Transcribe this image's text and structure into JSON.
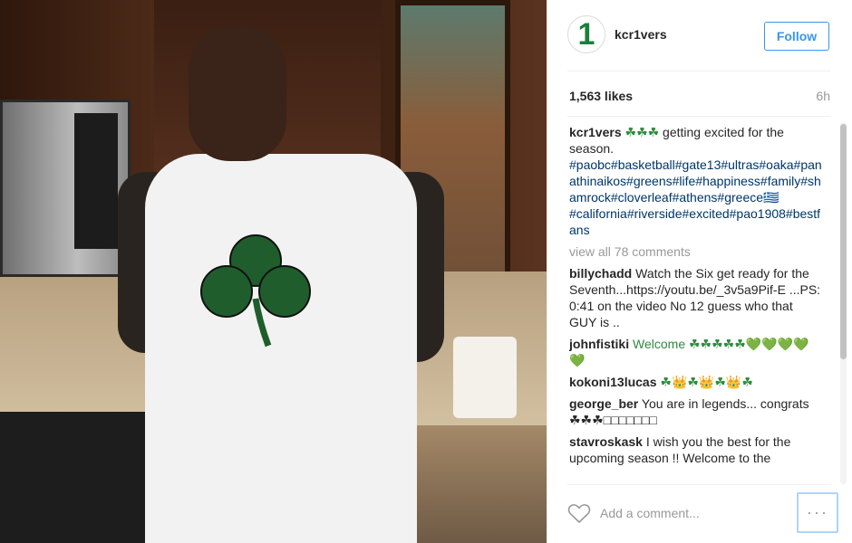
{
  "post": {
    "username": "kcr1vers",
    "avatar_glyph": "1",
    "follow_label": "Follow",
    "likes": "1,563 likes",
    "time": "6h",
    "caption_text": " getting excited for the season. ",
    "caption_emoji": "☘☘☘",
    "hashtags": "#paobc#basketball#gate13#ultras#oaka#panathinaikos#greens#life#happiness#family#shamrock#cloverleaf#athens#greece🇬🇷#california#riverside#excited#pao1908#bestfans",
    "view_all": "view all 78 comments"
  },
  "comments": [
    {
      "user": "billychadd",
      "text": "Watch the Six get ready for the Seventh...https://youtu.be/_3v5a9Pif-E ...PS: 0:41 on the video No 12 guess who that GUY is .."
    },
    {
      "user": "johnfistiki",
      "text": "Welcome ☘☘☘☘☘💚💚💚💚💚"
    },
    {
      "user": "kokoni13lucas",
      "text": "☘👑☘👑☘👑☘"
    },
    {
      "user": "george_ber",
      "text": "You are in legends... congrats ☘☘☘□□□□□□□"
    },
    {
      "user": "stavroskask",
      "text": "I wish you the best for the upcoming season !! Welcome to the"
    }
  ],
  "bottom": {
    "add_comment_placeholder": "Add a comment...",
    "more_label": "···"
  },
  "colors": {
    "accent": "#3897f0",
    "hashtag": "#003569",
    "muted": "#999999",
    "avatar_green": "#1a7f3b"
  },
  "icons": [
    "heart-icon",
    "more-options-icon"
  ]
}
